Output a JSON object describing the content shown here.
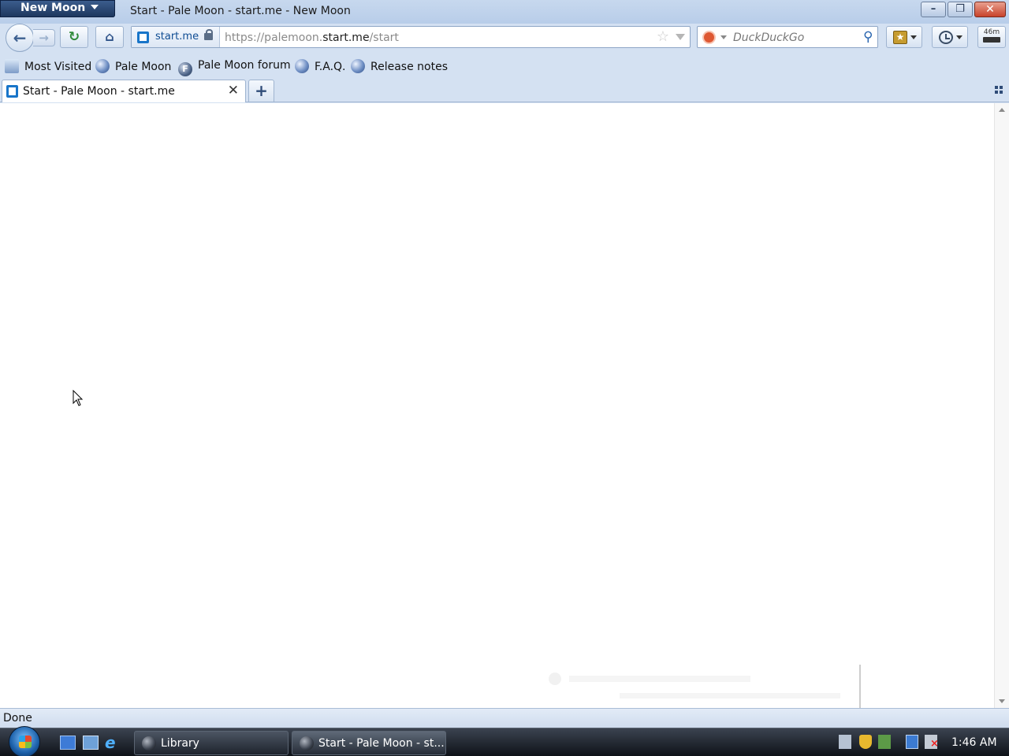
{
  "window": {
    "app_menu_label": "New Moon",
    "title": "Start - Pale Moon - start.me - New Moon"
  },
  "nav": {
    "identity_host": "start.me",
    "url_prefix": "https://palemoon.",
    "url_domain": "start.me",
    "url_path": "/start",
    "search_placeholder": "DuckDuckGo",
    "memory_label": "46m"
  },
  "bookmarks": [
    {
      "label": "Most Visited",
      "icon": "most-visited-icon"
    },
    {
      "label": "Pale Moon",
      "icon": "globe-icon"
    },
    {
      "label": "Pale Moon forum",
      "icon": "forum-icon"
    },
    {
      "label": "F.A.Q.",
      "icon": "globe-icon"
    },
    {
      "label": "Release notes",
      "icon": "globe-icon"
    }
  ],
  "tabs": [
    {
      "label": "Start - Pale Moon - start.me",
      "active": true
    }
  ],
  "status": {
    "text": "Done"
  },
  "taskbar": {
    "items": [
      {
        "label": "Library"
      },
      {
        "label": "Start - Pale Moon - st..."
      }
    ],
    "clock": "1:46 AM"
  }
}
